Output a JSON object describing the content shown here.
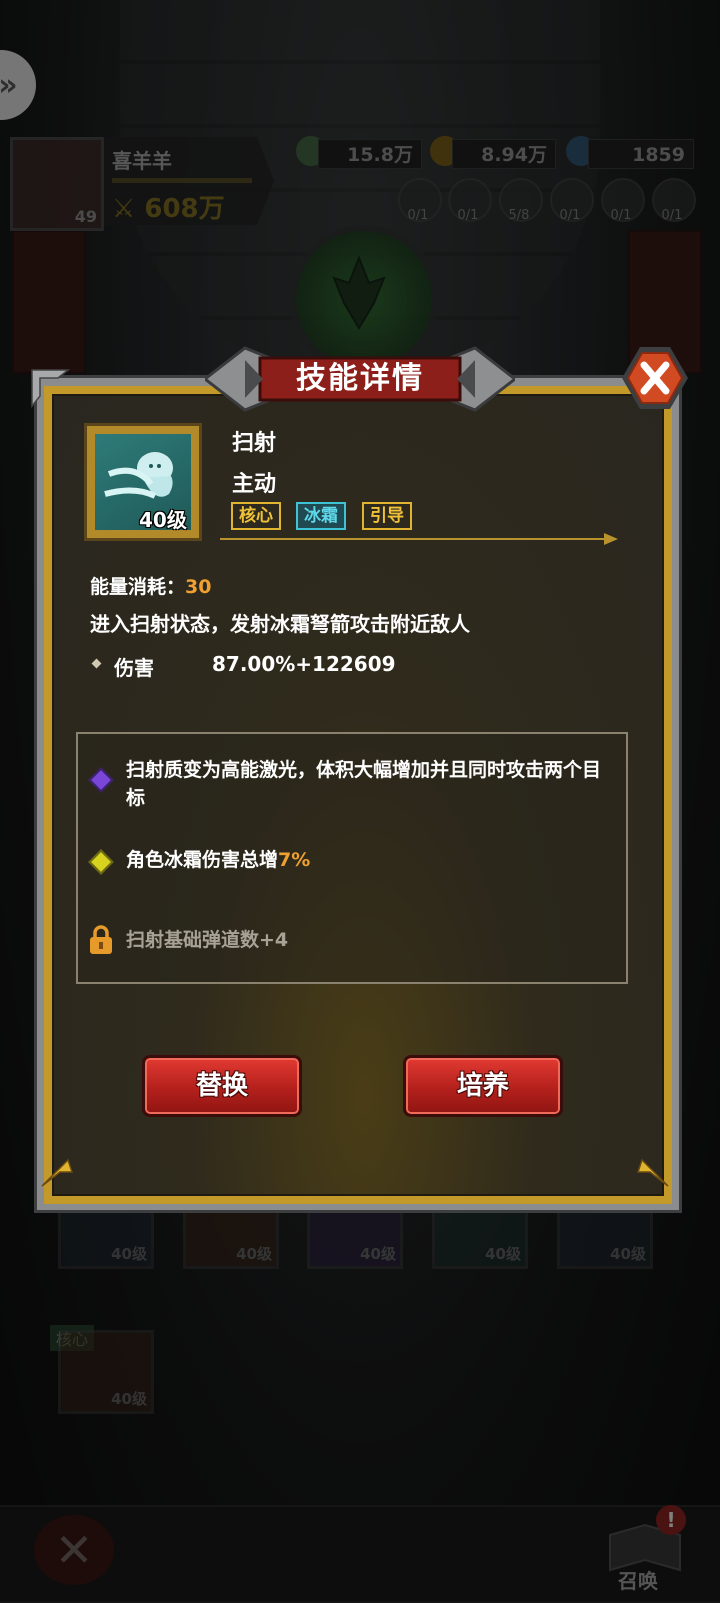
{
  "hud": {
    "player_name": "喜羊羊",
    "player_level": "49",
    "power": "608万",
    "resources": [
      {
        "name": "stamina",
        "value": "15.8万",
        "color": "#4a7a4a"
      },
      {
        "name": "gold",
        "value": "8.94万",
        "color": "#8a6a1a"
      },
      {
        "name": "gems",
        "value": "1859",
        "color": "#3a6a8a"
      }
    ],
    "element_counts": [
      "0/1",
      "0/1",
      "5/8",
      "0/1",
      "0/1",
      "0/1"
    ]
  },
  "dialog": {
    "title": "技能详情",
    "skill": {
      "level": "40级",
      "name": "扫射",
      "type": "主动",
      "tags": [
        "核心",
        "冰霜",
        "引导"
      ],
      "energy_label": "能量消耗：",
      "energy_value": "30",
      "description": "进入扫射状态，发射冰霜弩箭攻击附近敌人",
      "damage_label": "伤害",
      "damage_value": "87.00%+122609"
    },
    "upgrades": {
      "line1": "扫射质变为高能激光，体积大幅增加并且同时攻击两个目标",
      "line2_prefix": "角色冰霜伤害总增",
      "line2_value": "7%",
      "line3": "扫射基础弹道数+4"
    },
    "buttons": {
      "replace": "替换",
      "train": "培养"
    }
  },
  "bottom": {
    "tiles_level": "40级",
    "core_tag": "核心",
    "summon_label": "召唤",
    "summon_alert": "!"
  },
  "colors": {
    "gold_frame": "#c39a2a",
    "energy_highlight": "#f0a030",
    "frost_tag": "#5ed8ea",
    "button_red": "#d0302a"
  }
}
